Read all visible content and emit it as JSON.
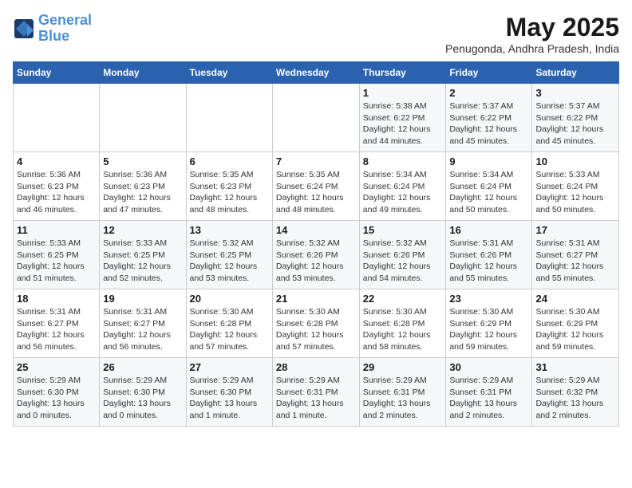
{
  "header": {
    "logo_line1": "General",
    "logo_line2": "Blue",
    "month_title": "May 2025",
    "location": "Penugonda, Andhra Pradesh, India"
  },
  "weekdays": [
    "Sunday",
    "Monday",
    "Tuesday",
    "Wednesday",
    "Thursday",
    "Friday",
    "Saturday"
  ],
  "weeks": [
    [
      {
        "day": "",
        "info": ""
      },
      {
        "day": "",
        "info": ""
      },
      {
        "day": "",
        "info": ""
      },
      {
        "day": "",
        "info": ""
      },
      {
        "day": "1",
        "info": "Sunrise: 5:38 AM\nSunset: 6:22 PM\nDaylight: 12 hours and 44 minutes."
      },
      {
        "day": "2",
        "info": "Sunrise: 5:37 AM\nSunset: 6:22 PM\nDaylight: 12 hours and 45 minutes."
      },
      {
        "day": "3",
        "info": "Sunrise: 5:37 AM\nSunset: 6:22 PM\nDaylight: 12 hours and 45 minutes."
      }
    ],
    [
      {
        "day": "4",
        "info": "Sunrise: 5:36 AM\nSunset: 6:23 PM\nDaylight: 12 hours and 46 minutes."
      },
      {
        "day": "5",
        "info": "Sunrise: 5:36 AM\nSunset: 6:23 PM\nDaylight: 12 hours and 47 minutes."
      },
      {
        "day": "6",
        "info": "Sunrise: 5:35 AM\nSunset: 6:23 PM\nDaylight: 12 hours and 48 minutes."
      },
      {
        "day": "7",
        "info": "Sunrise: 5:35 AM\nSunset: 6:24 PM\nDaylight: 12 hours and 48 minutes."
      },
      {
        "day": "8",
        "info": "Sunrise: 5:34 AM\nSunset: 6:24 PM\nDaylight: 12 hours and 49 minutes."
      },
      {
        "day": "9",
        "info": "Sunrise: 5:34 AM\nSunset: 6:24 PM\nDaylight: 12 hours and 50 minutes."
      },
      {
        "day": "10",
        "info": "Sunrise: 5:33 AM\nSunset: 6:24 PM\nDaylight: 12 hours and 50 minutes."
      }
    ],
    [
      {
        "day": "11",
        "info": "Sunrise: 5:33 AM\nSunset: 6:25 PM\nDaylight: 12 hours and 51 minutes."
      },
      {
        "day": "12",
        "info": "Sunrise: 5:33 AM\nSunset: 6:25 PM\nDaylight: 12 hours and 52 minutes."
      },
      {
        "day": "13",
        "info": "Sunrise: 5:32 AM\nSunset: 6:25 PM\nDaylight: 12 hours and 53 minutes."
      },
      {
        "day": "14",
        "info": "Sunrise: 5:32 AM\nSunset: 6:26 PM\nDaylight: 12 hours and 53 minutes."
      },
      {
        "day": "15",
        "info": "Sunrise: 5:32 AM\nSunset: 6:26 PM\nDaylight: 12 hours and 54 minutes."
      },
      {
        "day": "16",
        "info": "Sunrise: 5:31 AM\nSunset: 6:26 PM\nDaylight: 12 hours and 55 minutes."
      },
      {
        "day": "17",
        "info": "Sunrise: 5:31 AM\nSunset: 6:27 PM\nDaylight: 12 hours and 55 minutes."
      }
    ],
    [
      {
        "day": "18",
        "info": "Sunrise: 5:31 AM\nSunset: 6:27 PM\nDaylight: 12 hours and 56 minutes."
      },
      {
        "day": "19",
        "info": "Sunrise: 5:31 AM\nSunset: 6:27 PM\nDaylight: 12 hours and 56 minutes."
      },
      {
        "day": "20",
        "info": "Sunrise: 5:30 AM\nSunset: 6:28 PM\nDaylight: 12 hours and 57 minutes."
      },
      {
        "day": "21",
        "info": "Sunrise: 5:30 AM\nSunset: 6:28 PM\nDaylight: 12 hours and 57 minutes."
      },
      {
        "day": "22",
        "info": "Sunrise: 5:30 AM\nSunset: 6:28 PM\nDaylight: 12 hours and 58 minutes."
      },
      {
        "day": "23",
        "info": "Sunrise: 5:30 AM\nSunset: 6:29 PM\nDaylight: 12 hours and 59 minutes."
      },
      {
        "day": "24",
        "info": "Sunrise: 5:30 AM\nSunset: 6:29 PM\nDaylight: 12 hours and 59 minutes."
      }
    ],
    [
      {
        "day": "25",
        "info": "Sunrise: 5:29 AM\nSunset: 6:30 PM\nDaylight: 13 hours and 0 minutes."
      },
      {
        "day": "26",
        "info": "Sunrise: 5:29 AM\nSunset: 6:30 PM\nDaylight: 13 hours and 0 minutes."
      },
      {
        "day": "27",
        "info": "Sunrise: 5:29 AM\nSunset: 6:30 PM\nDaylight: 13 hours and 1 minute."
      },
      {
        "day": "28",
        "info": "Sunrise: 5:29 AM\nSunset: 6:31 PM\nDaylight: 13 hours and 1 minute."
      },
      {
        "day": "29",
        "info": "Sunrise: 5:29 AM\nSunset: 6:31 PM\nDaylight: 13 hours and 2 minutes."
      },
      {
        "day": "30",
        "info": "Sunrise: 5:29 AM\nSunset: 6:31 PM\nDaylight: 13 hours and 2 minutes."
      },
      {
        "day": "31",
        "info": "Sunrise: 5:29 AM\nSunset: 6:32 PM\nDaylight: 13 hours and 2 minutes."
      }
    ]
  ]
}
